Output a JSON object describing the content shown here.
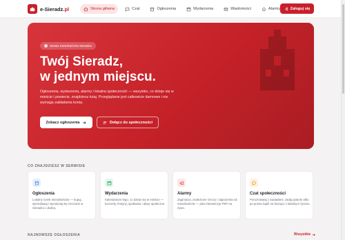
{
  "header": {
    "logo_text_main": "e-Sieradz",
    "logo_text_suffix": ".pl",
    "nav": [
      {
        "label": "Strona główna",
        "icon": "home-icon",
        "active": true
      },
      {
        "label": "Czat",
        "icon": "chat-icon",
        "active": false
      },
      {
        "label": "Ogłoszenia",
        "icon": "storefront-icon",
        "active": false
      },
      {
        "label": "Wydarzenia",
        "icon": "calendar-icon",
        "active": false
      },
      {
        "label": "Wiadomości",
        "icon": "mail-icon",
        "active": false
      },
      {
        "label": "Alarmy",
        "icon": "bell-icon",
        "active": false
      }
    ],
    "login_label": "Zaloguj się"
  },
  "hero": {
    "badge": "Serwis mieszkańców Sieradza",
    "title_line1": "Twój Sieradz,",
    "title_line2": "w jednym miejscu.",
    "description": "Ogłoszenia, wydarzenia, alarmy i lokalna społeczność — wszystko, co dzieje się w mieście i powiecie, znajdziesz tutaj. Przeglądanie jest całkowicie darmowe i nie wymaga zakładania konta.",
    "primary_button": "Zobacz ogłoszenia",
    "secondary_button": "Dołącz do społeczności"
  },
  "features": {
    "heading": "CO ZNAJDZIESZ W SERWISIE",
    "cards": [
      {
        "title": "Ogłoszenia",
        "icon": "storefront-icon",
        "color": "#3b7be0",
        "bg": "#e6efff",
        "description": "Lokalny rynek mieszkańców — kupuj, sprzedawaj i wymieniaj się rzeczami w Sieradzu i okolicy."
      },
      {
        "title": "Wydarzenia",
        "icon": "calendar-icon",
        "color": "#22a35a",
        "bg": "#e2f6ea",
        "description": "Kalendarium tego, co dzieje się w mieście — koncerty, festyny, spotkania i akcje społeczne."
      },
      {
        "title": "Alarmy",
        "icon": "megaphone-icon",
        "color": "#d23a3a",
        "bg": "#fde6e6",
        "description": "Zaginięcia, znalezione rzeczy i zagrożenia od mieszkańców — plus interwencje PSP na żywo."
      },
      {
        "title": "Czat społeczności",
        "icon": "chat-icon",
        "color": "#d99a12",
        "bg": "#fdf1dc",
        "description": "Porozmawiaj z sąsiadami, zadaj pytanie albo po prostu bądź na bieżąco z lokalnym życiem."
      }
    ]
  },
  "latest": {
    "heading": "NAJNOWSZE OGŁOSZENIA",
    "see_all": "Wszystkie"
  },
  "colors": {
    "brand": "#c8202b"
  }
}
